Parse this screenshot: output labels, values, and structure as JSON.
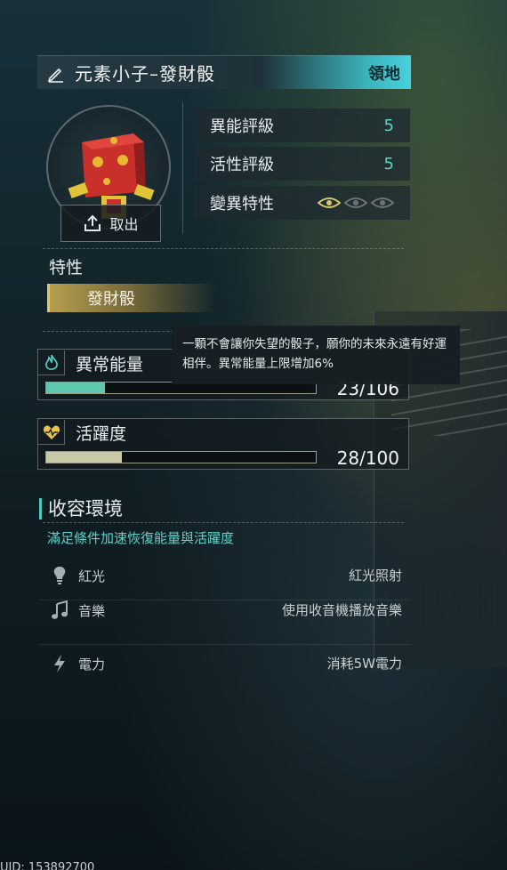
{
  "header": {
    "title": "元素小子–發財骰",
    "tag": "領地"
  },
  "take_out": {
    "label": "取出"
  },
  "stats": [
    {
      "label": "異能評級",
      "value": "5"
    },
    {
      "label": "活性評級",
      "value": "5"
    },
    {
      "label": "變異特性",
      "value": ""
    }
  ],
  "mutation_eyes": {
    "active": 1,
    "total": 3
  },
  "traits": {
    "title": "特性",
    "chip": "發財骰"
  },
  "tooltip": {
    "text": "一顆不會讓你失望的骰子，願你的未來永遠有好運相伴。異常能量上限增加6%"
  },
  "energy": {
    "label": "異常能量",
    "value_text": "23/106",
    "current": 23,
    "max": 106,
    "color": "#5fc7b0"
  },
  "vitality": {
    "label": "活躍度",
    "value_text": "28/100",
    "current": 28,
    "max": 100,
    "color": "#c8c9a6"
  },
  "environment": {
    "title": "收容環境",
    "subtitle": "滿足條件加速恢復能量與活躍度",
    "rows": [
      {
        "icon": "bulb-icon",
        "name": "紅光",
        "desc": "紅光照射"
      },
      {
        "icon": "music-icon",
        "name": "音樂",
        "desc": "使用收音機播放音樂"
      },
      {
        "icon": "lightning-icon",
        "name": "電力",
        "desc": "消耗5W電力"
      }
    ]
  },
  "footer": {
    "uid": "UID: 153892700"
  }
}
